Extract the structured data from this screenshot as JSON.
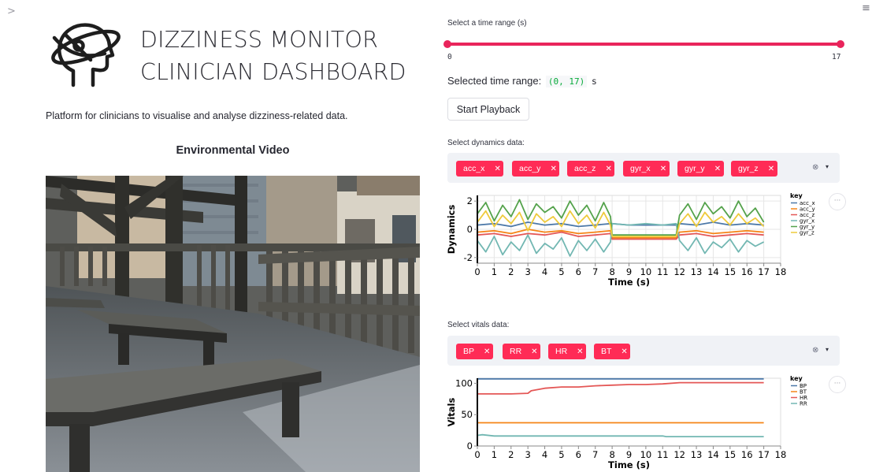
{
  "nav": {
    "sidebar_toggle_glyph": ">",
    "menu_glyph": "≡"
  },
  "header": {
    "title_line1": "DIZZINESS MONITOR",
    "title_line2": "CLINICIAN DASHBOARD",
    "logo_icon": "head-orbit-icon"
  },
  "description": "Platform for clinicians to visualise and analyse dizziness-related data.",
  "video": {
    "heading": "Environmental Video"
  },
  "time_range": {
    "label": "Select a time range (s)",
    "min_label": "0",
    "max_label": "17",
    "selected_prefix": "Selected time range:",
    "selected_value": "(0, 17)",
    "selected_unit": "s",
    "accent_color": "#e9245b"
  },
  "playback": {
    "button_label": "Start Playback"
  },
  "dynamics_select": {
    "label": "Select dynamics data:",
    "chips": [
      {
        "label": "acc_x"
      },
      {
        "label": "acc_y"
      },
      {
        "label": "acc_z"
      },
      {
        "label": "gyr_x"
      },
      {
        "label": "gyr_y"
      },
      {
        "label": "gyr_z"
      }
    ],
    "chip_remove_glyph": "✕",
    "clear_glyph": "⊗",
    "caret_glyph": "▾"
  },
  "vitals_select": {
    "label": "Select vitals data:",
    "chips": [
      {
        "label": "BP"
      },
      {
        "label": "RR"
      },
      {
        "label": "HR"
      },
      {
        "label": "BT"
      }
    ],
    "chip_remove_glyph": "✕",
    "clear_glyph": "⊗",
    "caret_glyph": "▾"
  },
  "chart_menu_glyph": "···",
  "chart_data": [
    {
      "type": "line",
      "xlabel": "Time (s)",
      "ylabel": "Dynamics",
      "xlim": [
        0,
        18
      ],
      "ylim": [
        -2.4,
        2.4
      ],
      "xticks": [
        0,
        1,
        2,
        3,
        4,
        5,
        6,
        7,
        8,
        9,
        10,
        11,
        12,
        13,
        14,
        15,
        16,
        17,
        18
      ],
      "yticks": [
        -2,
        0,
        2
      ],
      "grid": true,
      "cursor_x": 0,
      "legend_title": "key",
      "legend_position": "right",
      "series": [
        {
          "name": "acc_x",
          "color": "#4c78a8",
          "x": [
            0,
            1,
            2,
            3,
            4,
            5,
            6,
            7,
            7.9,
            8,
            9,
            10,
            11,
            11.8,
            12,
            13,
            14,
            15,
            16,
            17
          ],
          "y": [
            0.3,
            0.4,
            0.2,
            0.5,
            0.3,
            0.4,
            0.2,
            0.3,
            0.4,
            0.4,
            0.3,
            0.3,
            0.3,
            0.3,
            0.4,
            0.3,
            0.5,
            0.3,
            0.4,
            0.3
          ]
        },
        {
          "name": "acc_y",
          "color": "#f58518",
          "x": [
            0,
            1,
            2,
            3,
            4,
            5,
            6,
            7,
            7.9,
            8,
            9,
            10,
            11,
            11.8,
            12,
            13,
            14,
            15,
            16,
            17
          ],
          "y": [
            -0.2,
            -0.1,
            -0.3,
            0,
            -0.2,
            -0.1,
            -0.3,
            -0.2,
            -0.1,
            -0.6,
            -0.6,
            -0.6,
            -0.6,
            -0.6,
            -0.2,
            -0.1,
            -0.3,
            -0.2,
            -0.1,
            -0.2
          ]
        },
        {
          "name": "acc_z",
          "color": "#e45756",
          "x": [
            0,
            1,
            2,
            3,
            4,
            5,
            6,
            7,
            7.9,
            8,
            9,
            10,
            11,
            11.8,
            12,
            13,
            14,
            15,
            16,
            17
          ],
          "y": [
            -0.4,
            -0.3,
            -0.5,
            -0.3,
            -0.4,
            -0.2,
            -0.5,
            -0.4,
            -0.3,
            -0.7,
            -0.7,
            -0.7,
            -0.7,
            -0.7,
            -0.4,
            -0.3,
            -0.5,
            -0.4,
            -0.3,
            -0.4
          ]
        },
        {
          "name": "gyr_x",
          "color": "#72b7b2",
          "x": [
            0,
            0.5,
            1,
            1.5,
            2,
            2.5,
            3,
            3.5,
            4,
            4.5,
            5,
            5.5,
            6,
            6.5,
            7,
            7.5,
            7.9,
            8,
            9,
            10,
            11,
            11.8,
            12,
            12.5,
            13,
            13.5,
            14,
            14.5,
            15,
            15.5,
            16,
            16.5,
            17
          ],
          "y": [
            -0.8,
            -1.6,
            -0.5,
            -1.8,
            -0.9,
            -1.5,
            -0.4,
            -1.7,
            -1.0,
            -1.4,
            -0.6,
            -1.9,
            -0.8,
            -1.5,
            -0.7,
            -1.6,
            -0.9,
            0.4,
            0.3,
            0.4,
            0.3,
            0.4,
            -0.8,
            -1.5,
            -0.6,
            -1.7,
            -0.9,
            -1.3,
            -0.7,
            -1.6,
            -0.8,
            -1.2,
            -0.9
          ]
        },
        {
          "name": "gyr_y",
          "color": "#54a24b",
          "x": [
            0,
            0.5,
            1,
            1.5,
            2,
            2.5,
            3,
            3.5,
            4,
            4.5,
            5,
            5.5,
            6,
            6.5,
            7,
            7.5,
            7.9,
            8,
            9,
            10,
            11,
            11.8,
            12,
            12.5,
            13,
            13.5,
            14,
            14.5,
            15,
            15.5,
            16,
            16.5,
            17
          ],
          "y": [
            1.1,
            1.9,
            0.6,
            1.7,
            0.9,
            2.1,
            0.7,
            1.8,
            1.2,
            1.6,
            0.8,
            2.0,
            1.0,
            1.7,
            0.6,
            1.9,
            0.9,
            -0.4,
            -0.4,
            -0.4,
            -0.4,
            -0.4,
            1.0,
            1.8,
            0.7,
            1.9,
            1.1,
            1.6,
            0.8,
            2.0,
            0.9,
            1.5,
            0.5
          ]
        },
        {
          "name": "gyr_z",
          "color": "#eeca3b",
          "x": [
            0,
            0.5,
            1,
            1.5,
            2,
            2.5,
            3,
            3.5,
            4,
            4.5,
            5,
            5.5,
            6,
            6.5,
            7,
            7.5,
            7.9,
            8,
            9,
            10,
            11,
            11.8,
            12,
            12.5,
            13,
            13.5,
            14,
            14.5,
            15,
            15.5,
            16,
            16.5,
            17
          ],
          "y": [
            0.5,
            1.3,
            0.2,
            1.0,
            0.4,
            1.2,
            -0.1,
            1.1,
            0.5,
            0.9,
            0.2,
            1.3,
            0.4,
            1.0,
            0.1,
            1.2,
            0.3,
            -0.5,
            -0.5,
            -0.5,
            -0.5,
            -0.5,
            0.4,
            1.1,
            0.2,
            1.2,
            0.5,
            0.9,
            0.3,
            1.1,
            0.4,
            0.8,
            0.2
          ]
        }
      ]
    },
    {
      "type": "line",
      "xlabel": "Time (s)",
      "ylabel": "Vitals",
      "xlim": [
        0,
        18
      ],
      "ylim": [
        0,
        108
      ],
      "xticks": [
        0,
        1,
        2,
        3,
        4,
        5,
        6,
        7,
        8,
        9,
        10,
        11,
        12,
        13,
        14,
        15,
        16,
        17,
        18
      ],
      "yticks": [
        0,
        50,
        100
      ],
      "grid": false,
      "cursor_x": 0,
      "legend_title": "key",
      "legend_position": "right",
      "series": [
        {
          "name": "BP",
          "color": "#4c78a8",
          "x": [
            0,
            17
          ],
          "y": [
            107,
            107
          ]
        },
        {
          "name": "BT",
          "color": "#f58518",
          "x": [
            0,
            17
          ],
          "y": [
            37,
            37
          ]
        },
        {
          "name": "HR",
          "color": "#e45756",
          "x": [
            0,
            1,
            2,
            3,
            3.2,
            4,
            5,
            6,
            7,
            8,
            9,
            10,
            11,
            12,
            13,
            14,
            15,
            16,
            17
          ],
          "y": [
            83,
            83,
            83,
            84,
            88,
            92,
            94,
            94,
            96,
            97,
            98,
            98,
            99,
            101,
            101,
            101,
            101,
            101,
            101
          ]
        },
        {
          "name": "RR",
          "color": "#72b7b2",
          "x": [
            0,
            0.3,
            1,
            2,
            3,
            4,
            5,
            6,
            7,
            8,
            9,
            10,
            11,
            11.2,
            12,
            13,
            14,
            15,
            16,
            17
          ],
          "y": [
            17,
            18,
            16,
            16,
            16,
            16,
            16,
            16,
            16,
            16,
            16,
            16,
            16,
            15,
            15,
            15,
            15,
            15,
            15,
            15
          ]
        }
      ]
    }
  ]
}
